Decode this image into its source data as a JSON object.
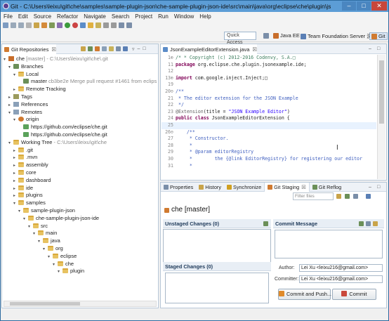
{
  "window": {
    "title": "Git - C:\\Users\\leixu\\git\\che\\samples\\sample-plugin-json\\che-sample-plugin-json-ide\\src\\main\\java\\org\\eclipse\\che\\plugin\\jsonexample\\..."
  },
  "menu": [
    "File",
    "Edit",
    "Source",
    "Refactor",
    "Navigate",
    "Search",
    "Project",
    "Run",
    "Window",
    "Help"
  ],
  "perspective_bar": {
    "quick_access": "Quick Access",
    "perspectives": [
      "Java EE",
      "Team Foundation Server 浏览",
      "Git"
    ]
  },
  "git_repositories": {
    "title": "Git Repositories",
    "nodes": [
      {
        "depth": 0,
        "twisty": "▾",
        "icon": "repo",
        "label": "che",
        "extra": " [master] - C:\\Users\\leixu\\git\\che\\.git"
      },
      {
        "depth": 1,
        "twisty": "▾",
        "icon": "branch",
        "label": "Branches",
        "extra": ""
      },
      {
        "depth": 2,
        "twisty": "▾",
        "icon": "folder",
        "label": "Local",
        "extra": ""
      },
      {
        "depth": 3,
        "twisty": "",
        "icon": "branch",
        "label": "master",
        "extra": " cb3be2e Merge pull request #1461 from eclipse/"
      },
      {
        "depth": 2,
        "twisty": "▸",
        "icon": "folder",
        "label": "Remote Tracking",
        "extra": ""
      },
      {
        "depth": 1,
        "twisty": "▸",
        "icon": "tag",
        "label": "Tags",
        "extra": ""
      },
      {
        "depth": 1,
        "twisty": "▸",
        "icon": "ref",
        "label": "References",
        "extra": ""
      },
      {
        "depth": 1,
        "twisty": "▾",
        "icon": "ref",
        "label": "Remotes",
        "extra": ""
      },
      {
        "depth": 2,
        "twisty": "▾",
        "icon": "remote",
        "label": "origin",
        "extra": ""
      },
      {
        "depth": 3,
        "twisty": "",
        "icon": "url",
        "label": "https://github.com/eclipse/che.git",
        "extra": ""
      },
      {
        "depth": 3,
        "twisty": "",
        "icon": "url",
        "label": "https://github.com/eclipse/che.git",
        "extra": ""
      },
      {
        "depth": 1,
        "twisty": "▾",
        "icon": "folder",
        "label": "Working Tree",
        "extra": " - C:\\Users\\leixu\\git\\che"
      },
      {
        "depth": 2,
        "twisty": "▸",
        "icon": "folder",
        "label": ".git",
        "extra": ""
      },
      {
        "depth": 2,
        "twisty": "▸",
        "icon": "folder",
        "label": ".mvn",
        "extra": ""
      },
      {
        "depth": 2,
        "twisty": "▸",
        "icon": "folder",
        "label": "assembly",
        "extra": ""
      },
      {
        "depth": 2,
        "twisty": "▸",
        "icon": "folder",
        "label": "core",
        "extra": ""
      },
      {
        "depth": 2,
        "twisty": "▸",
        "icon": "folder",
        "label": "dashboard",
        "extra": ""
      },
      {
        "depth": 2,
        "twisty": "▸",
        "icon": "folder",
        "label": "ide",
        "extra": ""
      },
      {
        "depth": 2,
        "twisty": "▸",
        "icon": "folder",
        "label": "plugins",
        "extra": ""
      },
      {
        "depth": 2,
        "twisty": "▾",
        "icon": "folder",
        "label": "samples",
        "extra": ""
      },
      {
        "depth": 3,
        "twisty": "▾",
        "icon": "folder",
        "label": "sample-plugin-json",
        "extra": ""
      },
      {
        "depth": 4,
        "twisty": "▾",
        "icon": "folder",
        "label": "che-sample-plugin-json-ide",
        "extra": ""
      },
      {
        "depth": 5,
        "twisty": "▾",
        "icon": "folder",
        "label": "src",
        "extra": ""
      },
      {
        "depth": 6,
        "twisty": "▾",
        "icon": "folder",
        "label": "main",
        "extra": ""
      },
      {
        "depth": 7,
        "twisty": "▾",
        "icon": "folder",
        "label": "java",
        "extra": ""
      },
      {
        "depth": 8,
        "twisty": "▾",
        "icon": "folder",
        "label": "org",
        "extra": ""
      },
      {
        "depth": 9,
        "twisty": "▾",
        "icon": "folder",
        "label": "eclipse",
        "extra": ""
      },
      {
        "depth": 10,
        "twisty": "▾",
        "icon": "folder",
        "label": "che",
        "extra": ""
      },
      {
        "depth": 11,
        "twisty": "▾",
        "icon": "folder",
        "label": "plugin",
        "extra": ""
      }
    ]
  },
  "editor": {
    "tab": "JsonExampleEditorExtension.java",
    "lines": [
      {
        "n": "1⊕",
        "parts": [
          [
            "cm",
            "/* * Copyright (c) 2012-2016 Codenvy, S.A.□"
          ]
        ]
      },
      {
        "n": "11",
        "parts": [
          [
            "kw",
            "package"
          ],
          [
            "",
            " org.eclipse.che.plugin.jsonexample.ide;"
          ]
        ]
      },
      {
        "n": "12",
        "parts": [
          [
            "",
            ""
          ]
        ]
      },
      {
        "n": "13⊕",
        "parts": [
          [
            "kw",
            "import"
          ],
          [
            "",
            " com.google.inject.Inject;□"
          ]
        ]
      },
      {
        "n": "19",
        "parts": [
          [
            "",
            ""
          ]
        ]
      },
      {
        "n": "20⊖",
        "parts": [
          [
            "cmd",
            "/**"
          ]
        ]
      },
      {
        "n": "21",
        "parts": [
          [
            "cmd",
            " * The editor extension for the JSON Example"
          ]
        ]
      },
      {
        "n": "22",
        "parts": [
          [
            "cmd",
            " */"
          ]
        ]
      },
      {
        "n": "23",
        "parts": [
          [
            "ann",
            "@Extension"
          ],
          [
            "",
            "(title = "
          ],
          [
            "str",
            "\"JSON Example Editor\""
          ],
          [
            "",
            ")"
          ]
        ]
      },
      {
        "n": "24",
        "parts": [
          [
            "kw",
            "public class"
          ],
          [
            "",
            " JsonExampleEditorExtension {"
          ]
        ]
      },
      {
        "n": "25",
        "parts": [
          [
            "",
            ""
          ]
        ],
        "current": true
      },
      {
        "n": "26⊖",
        "parts": [
          [
            "cmd",
            "    /**"
          ]
        ]
      },
      {
        "n": "27",
        "parts": [
          [
            "cmd",
            "     * Constructor."
          ]
        ]
      },
      {
        "n": "28",
        "parts": [
          [
            "cmd",
            "     *"
          ]
        ]
      },
      {
        "n": "29",
        "parts": [
          [
            "cmd",
            "     * @param editorRegistry"
          ]
        ]
      },
      {
        "n": "30",
        "parts": [
          [
            "cmd",
            "     *        the {@link EditorRegistry} for registering our editor"
          ]
        ]
      },
      {
        "n": "31",
        "parts": [
          [
            "cmd",
            "     *"
          ]
        ]
      }
    ]
  },
  "bottom_tabs": [
    "Properties",
    "History",
    "Synchronize",
    "Git Staging",
    "Git Reflog"
  ],
  "git_staging": {
    "filter_placeholder": "Filter files",
    "repo_label": "che [master]",
    "unstaged": "Unstaged Changes (0)",
    "staged": "Staged Changes (0)",
    "commit_message": "Commit Message",
    "author_label": "Author:",
    "author_value": "Lei Xu <leixu216@gmail.com>",
    "committer_label": "Committer:",
    "committer_value": "Lei Xu <leixu216@gmail.com>",
    "commit_and_push": "Commit and Push...",
    "commit": "Commit"
  },
  "colors": {
    "titlebar": "#5c9dd6",
    "close_button": "#c8463b",
    "keyword": "#7f0055",
    "comment": "#3f7f5f",
    "javadoc": "#3f5fbf",
    "string": "#2a00ff"
  }
}
